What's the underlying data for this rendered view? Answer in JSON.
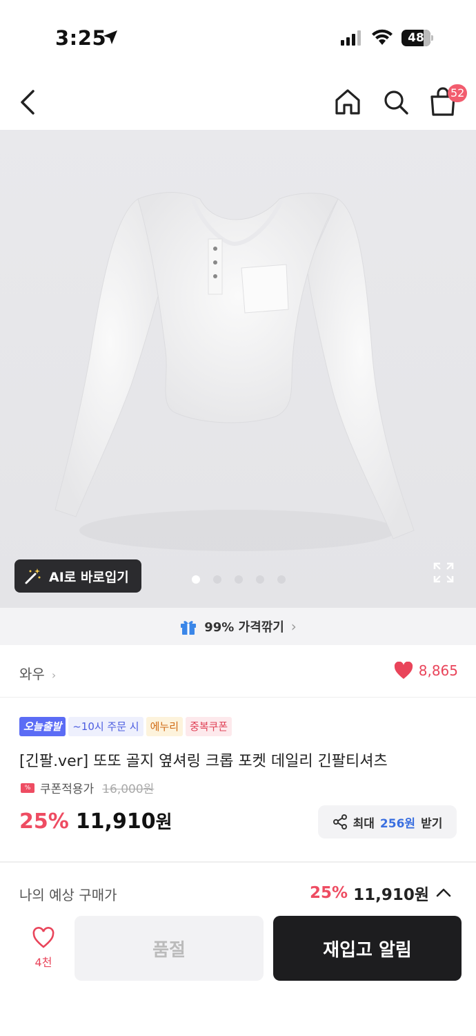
{
  "status_bar": {
    "time": "3:25",
    "battery": "48"
  },
  "nav": {
    "cart_count": "52",
    "icons": [
      "back-icon",
      "home-icon",
      "search-icon",
      "shopping-bag-icon"
    ]
  },
  "hero": {
    "ai_button_label": "AI로 바로입기",
    "carousel": {
      "total": 5,
      "current": 1
    }
  },
  "promo": {
    "label": "99% 가격깎기"
  },
  "brand": {
    "name": "와우",
    "likes": "8,865"
  },
  "product": {
    "tags": [
      "오늘출발",
      "~10시 주문 시",
      "에누리",
      "중복쿠폰"
    ],
    "title": "[긴팔.ver] 또또 골지 옆셔링 크롭 포켓 데일리 긴팔티셔츠",
    "coupon_label": "쿠폰적용가",
    "original_price": "16,000원",
    "discount": "25%",
    "price": "11,910",
    "price_unit": "원"
  },
  "share": {
    "prefix": "최대",
    "amount": "256원",
    "suffix": "받기"
  },
  "expected_price": {
    "label": "나의 예상 구매가",
    "discount": "25%",
    "amount": "11,910원"
  },
  "bottom_bar": {
    "wish_count": "4천",
    "soldout_label": "품절",
    "restock_label": "재입고 알림"
  },
  "colors": {
    "accent_red": "#ee4c62",
    "dark": "#1d1d1f",
    "blue": "#3a6fe0"
  }
}
